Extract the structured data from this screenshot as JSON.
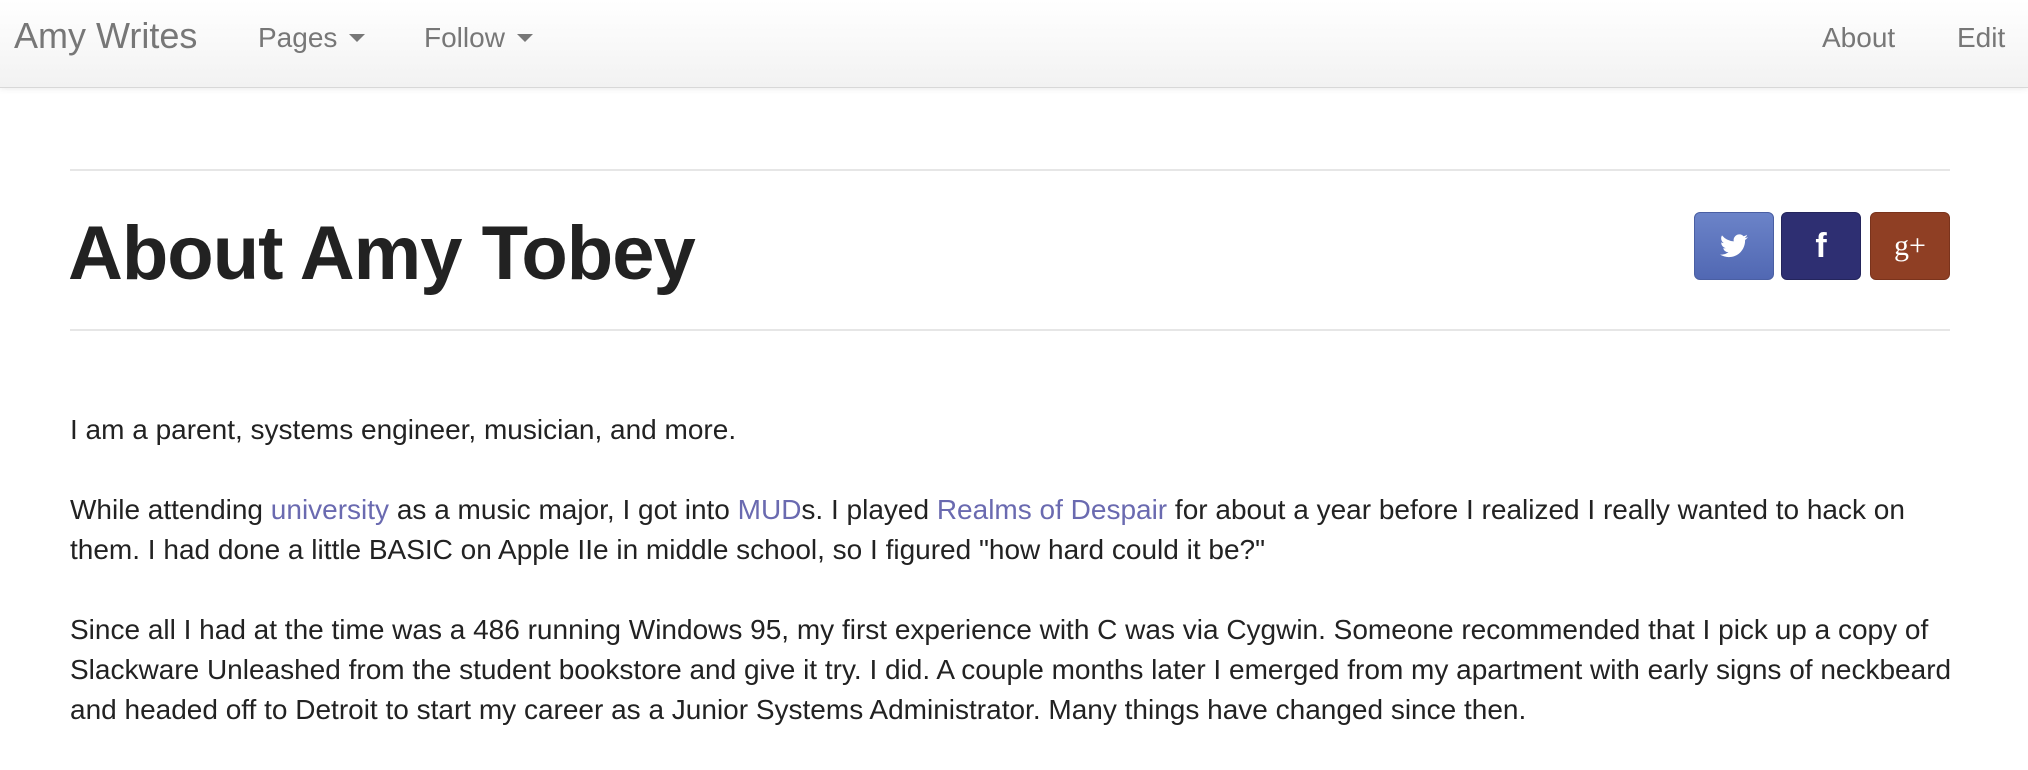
{
  "navbar": {
    "brand": "Amy Writes",
    "menu": [
      {
        "label": "Pages"
      },
      {
        "label": "Follow"
      }
    ],
    "right": [
      {
        "label": "About"
      },
      {
        "label": "Edit"
      }
    ]
  },
  "page": {
    "title": "About Amy Tobey"
  },
  "share": {
    "twitter_icon": "twitter-icon",
    "facebook_icon": "facebook-icon",
    "googleplus_icon": "google-plus-icon",
    "facebook_glyph": "f",
    "googleplus_glyph": "g+",
    "colors": {
      "twitter": "#5c74be",
      "facebook": "#2e2f72",
      "googleplus": "#8f3f24"
    }
  },
  "content": {
    "p1": "I am a parent, systems engineer, musician, and more.",
    "p2": {
      "t1": "While attending ",
      "link1": "university",
      "t2": " as a music major, I got into ",
      "link2": "MUD",
      "t3": "s. I played ",
      "link3": "Realms of Despair",
      "t4": " for about a year before I realized I really wanted to hack on them. I had done a little BASIC on Apple IIe in middle school, so I figured \"how hard could it be?\""
    },
    "p3": "Since all I had at the time was a 486 running Windows 95, my first experience with C was via Cygwin. Someone recommended that I pick up a copy of Slackware Unleashed from the student bookstore and give it try. I did. A couple months later I emerged from my apartment with early signs of neckbeard and headed off to Detroit to start my career as a Junior Systems Administrator. Many things have changed since then."
  },
  "colors": {
    "link": "#6a6ab0",
    "nav_text": "#777777",
    "body_text": "#222222"
  }
}
